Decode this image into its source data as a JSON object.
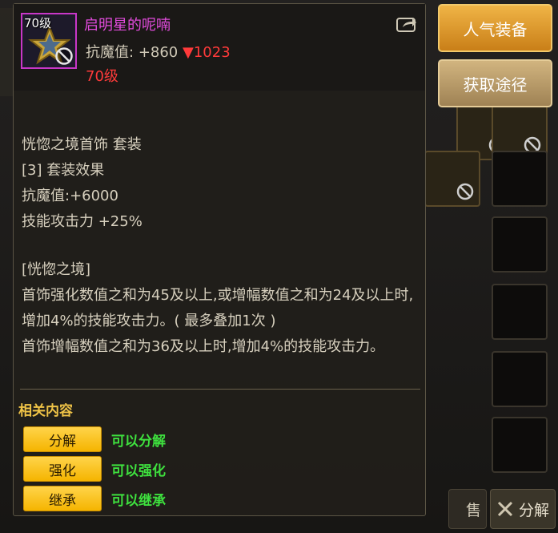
{
  "tooltip": {
    "item": {
      "level_badge": "70级",
      "name": "启明星的呢喃",
      "stat_label": "抗魔值:",
      "stat_value": "+860",
      "stat_diff": "▼1023",
      "level_required": "70级",
      "name_color": "#e14bdc"
    },
    "set": {
      "name_line": "恍惚之境首饰  套装",
      "effect_line": "[3] 套装效果",
      "stat_line": "抗魔值:+6000",
      "skill_line": "技能攻击力 +25%"
    },
    "effect": {
      "title": "[恍惚之境]",
      "line1": "首饰强化数值之和为45及以上,或增幅数值之和为24及以上时,增加4%的技能攻击力。( 最多叠加1次 )",
      "line2": "首饰增幅数值之和为36及以上时,增加4%的技能攻击力。"
    },
    "related": {
      "title": "相关内容",
      "actions": [
        {
          "label": "分解",
          "note": "可以分解"
        },
        {
          "label": "强化",
          "note": "可以强化"
        },
        {
          "label": "继承",
          "note": "可以继承"
        }
      ]
    }
  },
  "side_buttons": {
    "popular": "人气装备",
    "obtain": "获取途径"
  },
  "background": {
    "sell_label": "售",
    "decompose_label": "分解"
  },
  "colors": {
    "accent_gold": "#f0b446",
    "action_yellow": "#ffd44a",
    "note_green": "#3ee03e",
    "decrease_red": "#ff3a3a"
  }
}
